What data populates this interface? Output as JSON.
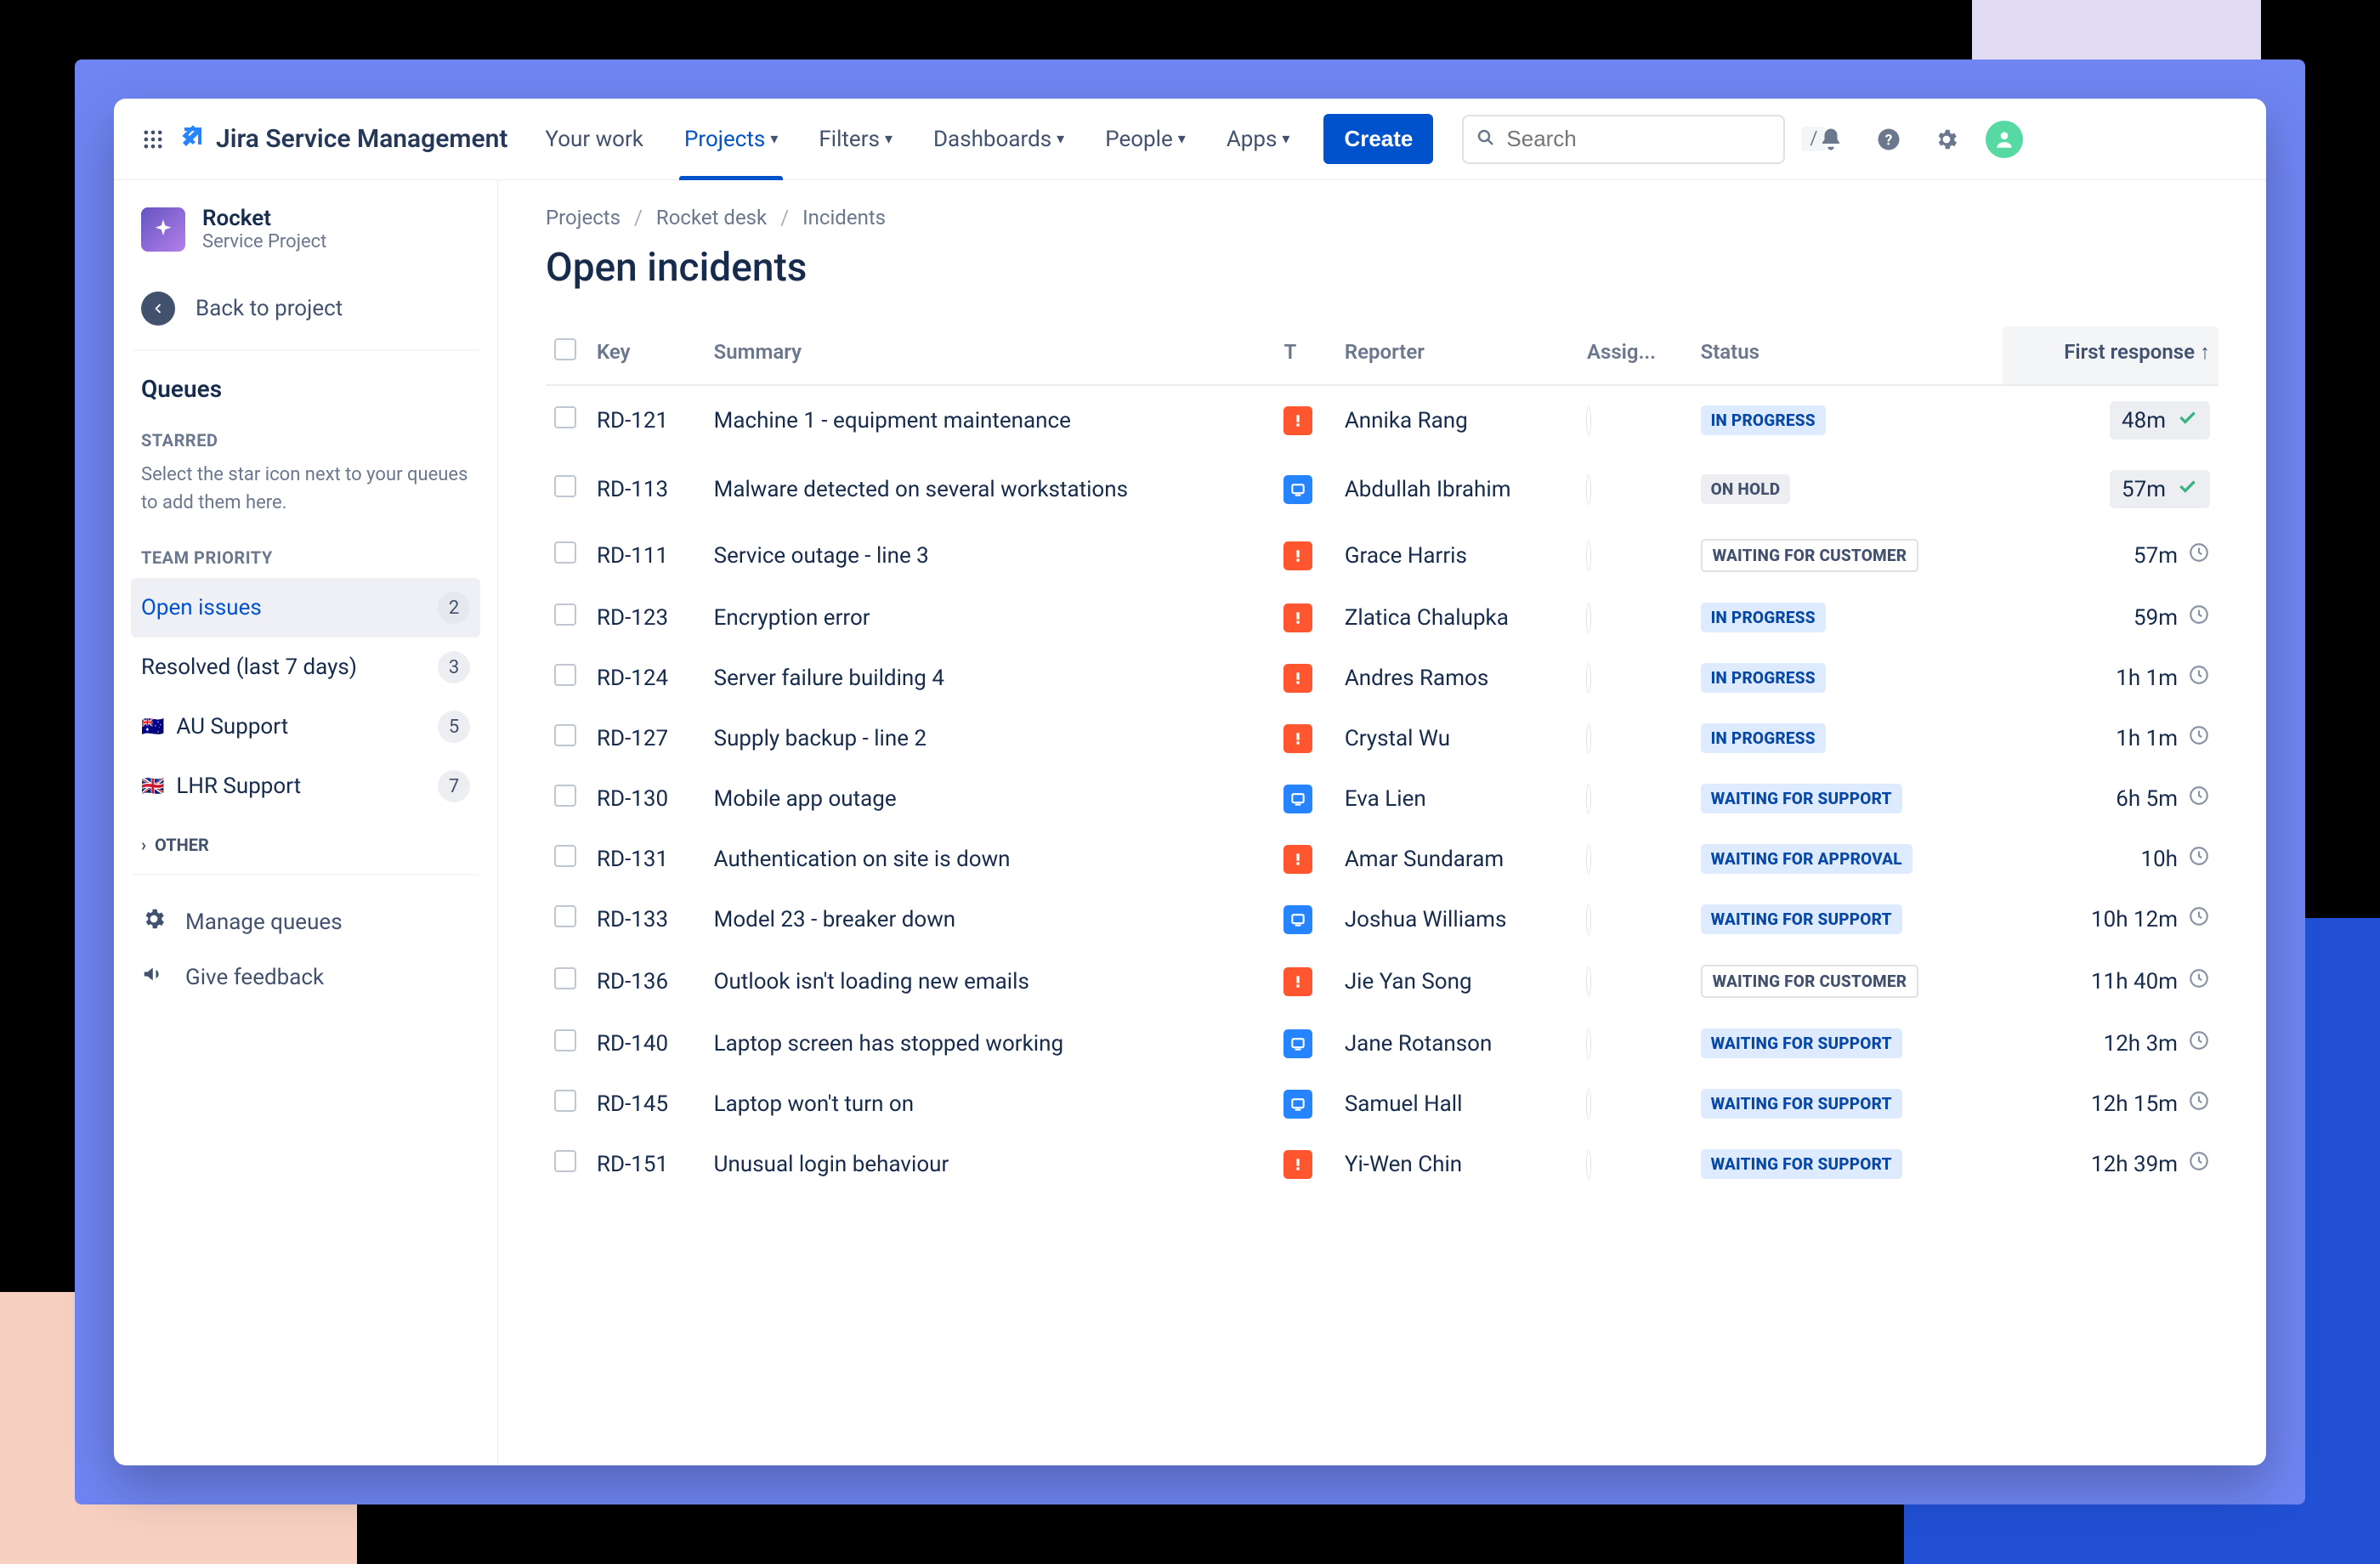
{
  "brand": "Jira Service Management",
  "nav": {
    "your_work": "Your work",
    "projects": "Projects",
    "filters": "Filters",
    "dashboards": "Dashboards",
    "people": "People",
    "apps": "Apps"
  },
  "create_label": "Create",
  "search": {
    "placeholder": "Search",
    "kbd": "/"
  },
  "sidebar": {
    "project_name": "Rocket",
    "project_type": "Service Project",
    "back_label": "Back to project",
    "queues_label": "Queues",
    "starred_label": "STARRED",
    "starred_hint": "Select the star icon next to your queues to add them here.",
    "team_priority_label": "TEAM PRIORITY",
    "queues": [
      {
        "label": "Open issues",
        "count": "2",
        "flag": "",
        "active": true
      },
      {
        "label": "Resolved (last 7 days)",
        "count": "3",
        "flag": "",
        "active": false
      },
      {
        "label": "AU Support",
        "count": "5",
        "flag": "🇦🇺",
        "active": false
      },
      {
        "label": "LHR Support",
        "count": "7",
        "flag": "🇬🇧",
        "active": false
      }
    ],
    "other_label": "OTHER",
    "manage_label": "Manage queues",
    "feedback_label": "Give feedback"
  },
  "breadcrumbs": [
    "Projects",
    "Rocket desk",
    "Incidents"
  ],
  "page_title": "Open incidents",
  "columns": {
    "key": "Key",
    "summary": "Summary",
    "type": "T",
    "reporter": "Reporter",
    "assignee": "Assig...",
    "status": "Status",
    "first_response": "First response"
  },
  "status_labels": {
    "inprogress": "IN PROGRESS",
    "onhold": "ON HOLD",
    "waitcustomer": "WAITING FOR CUSTOMER",
    "waitsupport": "WAITING FOR SUPPORT",
    "waitapproval": "WAITING FOR APPROVAL"
  },
  "rows": [
    {
      "key": "RD-121",
      "summary": "Machine 1 - equipment maintenance",
      "type": "orange",
      "reporter": "Annika Rang",
      "status": "inprogress",
      "resp": "48m",
      "sla": "met"
    },
    {
      "key": "RD-113",
      "summary": "Malware detected on several workstations",
      "type": "blue",
      "reporter": "Abdullah Ibrahim",
      "status": "onhold",
      "resp": "57m",
      "sla": "met"
    },
    {
      "key": "RD-111",
      "summary": "Service outage - line 3",
      "type": "orange",
      "reporter": "Grace Harris",
      "status": "waitcustomer",
      "resp": "57m",
      "sla": "clock"
    },
    {
      "key": "RD-123",
      "summary": "Encryption error",
      "type": "orange",
      "reporter": "Zlatica Chalupka",
      "status": "inprogress",
      "resp": "59m",
      "sla": "clock"
    },
    {
      "key": "RD-124",
      "summary": "Server failure building 4",
      "type": "orange",
      "reporter": "Andres Ramos",
      "status": "inprogress",
      "resp": "1h 1m",
      "sla": "clock"
    },
    {
      "key": "RD-127",
      "summary": "Supply backup - line 2",
      "type": "orange",
      "reporter": "Crystal Wu",
      "status": "inprogress",
      "resp": "1h 1m",
      "sla": "clock"
    },
    {
      "key": "RD-130",
      "summary": "Mobile app outage",
      "type": "blue",
      "reporter": "Eva Lien",
      "status": "waitsupport",
      "resp": "6h 5m",
      "sla": "clock"
    },
    {
      "key": "RD-131",
      "summary": "Authentication on site is down",
      "type": "orange",
      "reporter": "Amar Sundaram",
      "status": "waitapproval",
      "resp": "10h",
      "sla": "clock"
    },
    {
      "key": "RD-133",
      "summary": "Model 23 - breaker down",
      "type": "blue",
      "reporter": "Joshua Williams",
      "status": "waitsupport",
      "resp": "10h 12m",
      "sla": "clock"
    },
    {
      "key": "RD-136",
      "summary": "Outlook isn't loading new emails",
      "type": "orange",
      "reporter": "Jie Yan Song",
      "status": "waitcustomer",
      "resp": "11h 40m",
      "sla": "clock"
    },
    {
      "key": "RD-140",
      "summary": "Laptop screen has stopped working",
      "type": "blue",
      "reporter": "Jane Rotanson",
      "status": "waitsupport",
      "resp": "12h 3m",
      "sla": "clock"
    },
    {
      "key": "RD-145",
      "summary": "Laptop won't turn on",
      "type": "blue",
      "reporter": "Samuel Hall",
      "status": "waitsupport",
      "resp": "12h 15m",
      "sla": "clock"
    },
    {
      "key": "RD-151",
      "summary": "Unusual login behaviour",
      "type": "orange",
      "reporter": "Yi-Wen Chin",
      "status": "waitsupport",
      "resp": "12h 39m",
      "sla": "clock"
    }
  ]
}
